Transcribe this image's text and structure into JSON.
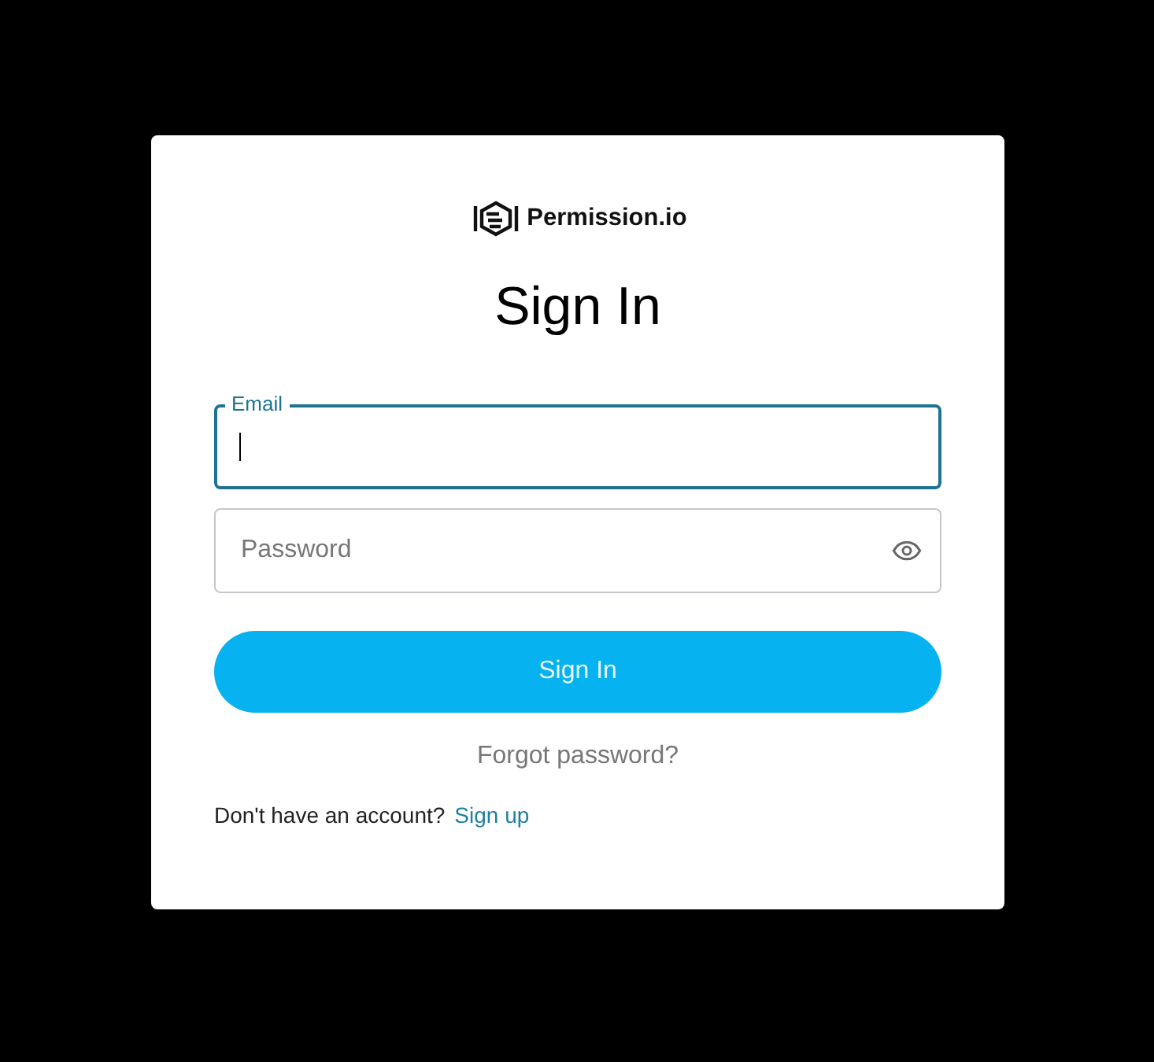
{
  "logo": {
    "text": "Permission.io"
  },
  "title": "Sign In",
  "fields": [
    {
      "kind": "email",
      "label": "Email",
      "focused": true
    },
    {
      "kind": "password",
      "placeholder": "Password",
      "focused": false
    }
  ],
  "submit_button": "Sign In",
  "forgot_link": "Forgot password?",
  "signup": {
    "prompt": "Don't have an account?",
    "link": "Sign up"
  }
}
